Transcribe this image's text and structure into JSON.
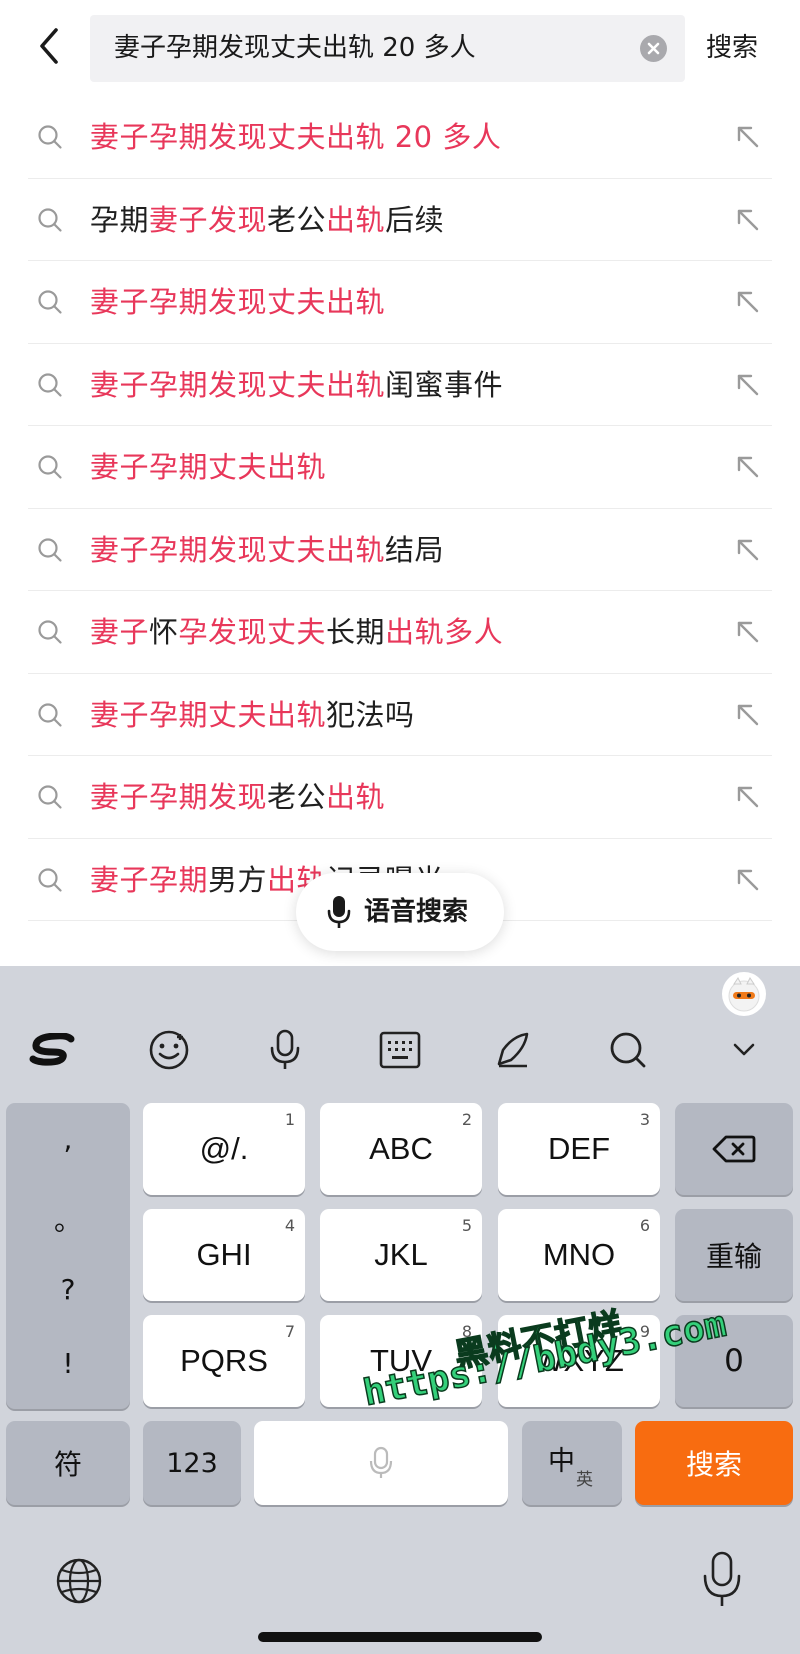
{
  "header": {
    "query": "妻子孕期发现丈夫出轨 20 多人",
    "search_button": "搜索"
  },
  "suggestions": [
    {
      "segments": [
        {
          "t": "妻子孕期发现丈夫出轨 20 多人",
          "h": true
        }
      ]
    },
    {
      "segments": [
        {
          "t": "孕期",
          "h": false
        },
        {
          "t": "妻子发现",
          "h": true
        },
        {
          "t": "老公",
          "h": false
        },
        {
          "t": "出轨",
          "h": true
        },
        {
          "t": "后续",
          "h": false
        }
      ]
    },
    {
      "segments": [
        {
          "t": "妻子孕期发现丈夫出轨",
          "h": true
        }
      ]
    },
    {
      "segments": [
        {
          "t": "妻子孕期发现丈夫出轨",
          "h": true
        },
        {
          "t": "闺蜜事件",
          "h": false
        }
      ]
    },
    {
      "segments": [
        {
          "t": "妻子孕期丈夫出轨",
          "h": true
        }
      ]
    },
    {
      "segments": [
        {
          "t": "妻子孕期发现丈夫出轨",
          "h": true
        },
        {
          "t": "结局",
          "h": false
        }
      ]
    },
    {
      "segments": [
        {
          "t": "妻子",
          "h": true
        },
        {
          "t": "怀",
          "h": false
        },
        {
          "t": "孕发现丈夫",
          "h": true
        },
        {
          "t": "长期",
          "h": false
        },
        {
          "t": "出轨多人",
          "h": true
        }
      ]
    },
    {
      "segments": [
        {
          "t": "妻子孕期丈夫出轨",
          "h": true
        },
        {
          "t": "犯法吗",
          "h": false
        }
      ]
    },
    {
      "segments": [
        {
          "t": "妻子孕期发现",
          "h": true
        },
        {
          "t": "老公",
          "h": false
        },
        {
          "t": "出轨",
          "h": true
        }
      ]
    },
    {
      "segments": [
        {
          "t": "妻子孕期",
          "h": true
        },
        {
          "t": "男方",
          "h": false
        },
        {
          "t": "出轨",
          "h": true
        },
        {
          "t": "记录曝光",
          "h": false
        }
      ]
    }
  ],
  "voice_search": {
    "label": "语音搜索"
  },
  "keyboard": {
    "punctuation": [
      ",",
      "。",
      "?",
      "!"
    ],
    "keys": [
      {
        "label": "@/.",
        "num": "1"
      },
      {
        "label": "ABC",
        "num": "2"
      },
      {
        "label": "DEF",
        "num": "3"
      },
      {
        "label": "GHI",
        "num": "4"
      },
      {
        "label": "JKL",
        "num": "5"
      },
      {
        "label": "MNO",
        "num": "6"
      },
      {
        "label": "PQRS",
        "num": "7"
      },
      {
        "label": "TUV",
        "num": "8"
      },
      {
        "label": "WXYZ",
        "num": "9"
      }
    ],
    "reenter": "重输",
    "zero": "0",
    "symbols": "符",
    "numbers": "123",
    "lang_main": "中",
    "lang_alt": "英",
    "search": "搜索"
  },
  "watermark": {
    "line1": "黑料不打烊",
    "line2": "https://bbdy3.com"
  },
  "colors": {
    "highlight": "#e8375a",
    "accent": "#f86c10",
    "keyboard_bg": "#d1d4db"
  },
  "icons": [
    "back-arrow-icon",
    "clear-icon",
    "search-icon",
    "fill-arrow-icon",
    "mic-icon",
    "sogou-logo-icon",
    "emoji-icon",
    "keyboard-icon",
    "pen-icon",
    "search-icon",
    "chevron-down-icon",
    "backspace-icon",
    "globe-icon"
  ]
}
